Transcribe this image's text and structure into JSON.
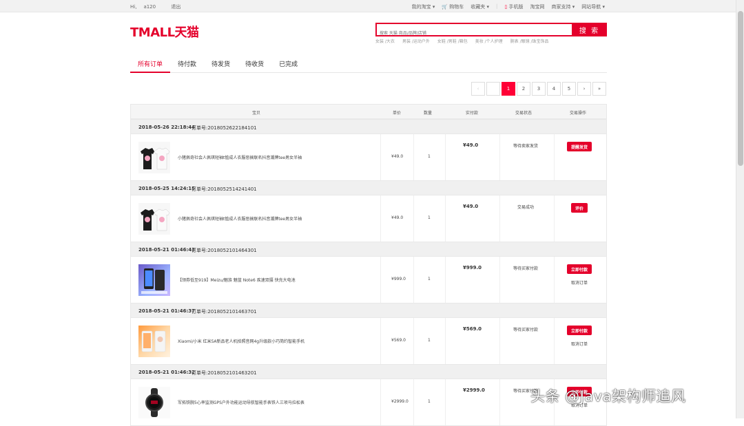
{
  "topbar": {
    "greeting": "Hi,",
    "username": "a120",
    "logout": "退出",
    "links": [
      "我的淘宝",
      "购物车",
      "收藏夹",
      "手机版",
      "淘宝网",
      "商家支持",
      "网站导航"
    ]
  },
  "header": {
    "logo": "TMALL天猫",
    "search_placeholder": "搜索 天猫 商品/品牌/店铺",
    "search_button": "搜 索",
    "hotwords": [
      "女装 /大衣",
      "男装 /运动户外",
      "女鞋 /男鞋 /箱包",
      "美妆 /个人护理",
      "腕表 /眼镜 /珠宝饰品"
    ]
  },
  "tabs": [
    "所有订单",
    "待付款",
    "待发货",
    "待收货",
    "已完成"
  ],
  "pagination": [
    "‹",
    "",
    "1",
    "2",
    "3",
    "4",
    "5",
    "›",
    "»"
  ],
  "table_headers": {
    "item": "宝贝",
    "unit_price": "单价",
    "quantity": "数量",
    "paid": "实付款",
    "status": "交易状态",
    "action": "交易操作"
  },
  "orders": [
    {
      "date": "2018-05-26 22:18:44",
      "order_no": "订单号:2018052622184101",
      "title": "小猪佩奇社会人佩琪短袖t恤成人衣服恶搞联名抖音潮牌tee男女半袖",
      "unit_price": "¥49.0",
      "quantity": "1",
      "paid": "¥49.0",
      "status": "等待卖家发货",
      "action": "提醒发货",
      "sub_action": ""
    },
    {
      "date": "2018-05-25 14:24:15",
      "order_no": "订单号:2018052514241401",
      "title": "小猪佩奇社会人佩琪短袖t恤成人衣服恶搞联名抖音潮牌tee男女半袖",
      "unit_price": "¥49.0",
      "quantity": "1",
      "paid": "¥49.0",
      "status": "交易成功",
      "action": "评价",
      "sub_action": ""
    },
    {
      "date": "2018-05-21 01:46:43",
      "order_no": "订单号:2018052101464301",
      "title": "【领券低至919】Meizu/魅族 魅蓝 Note6 疾速双摄 快充大电池",
      "unit_price": "¥999.0",
      "quantity": "1",
      "paid": "¥999.0",
      "status": "等待买家付款",
      "action": "立即付款",
      "sub_action": "取消订单"
    },
    {
      "date": "2018-05-21 01:46:37",
      "order_no": "订单号:2018052101463701",
      "title": "Xiaomi/小米 红米5A新品老人机拍照音网4g升级款小巧简约智能手机",
      "unit_price": "¥569.0",
      "quantity": "1",
      "paid": "¥569.0",
      "status": "等待买家付款",
      "action": "立即付款",
      "sub_action": "取消订单"
    },
    {
      "date": "2018-05-21 01:46:32",
      "order_no": "订单号:2018052101463201",
      "title": "军拓铁腕5心率监测GPS户外功能运动导航智能手表铁人三项马拉松表",
      "unit_price": "¥2999.0",
      "quantity": "1",
      "paid": "¥2999.0",
      "status": "等待买家付款",
      "action": "立即付款",
      "sub_action": "取消订单"
    }
  ],
  "watermark": "头条 @Java架构师追风",
  "colors": {
    "brand": "#e4002b",
    "accent": "#ff0036"
  }
}
